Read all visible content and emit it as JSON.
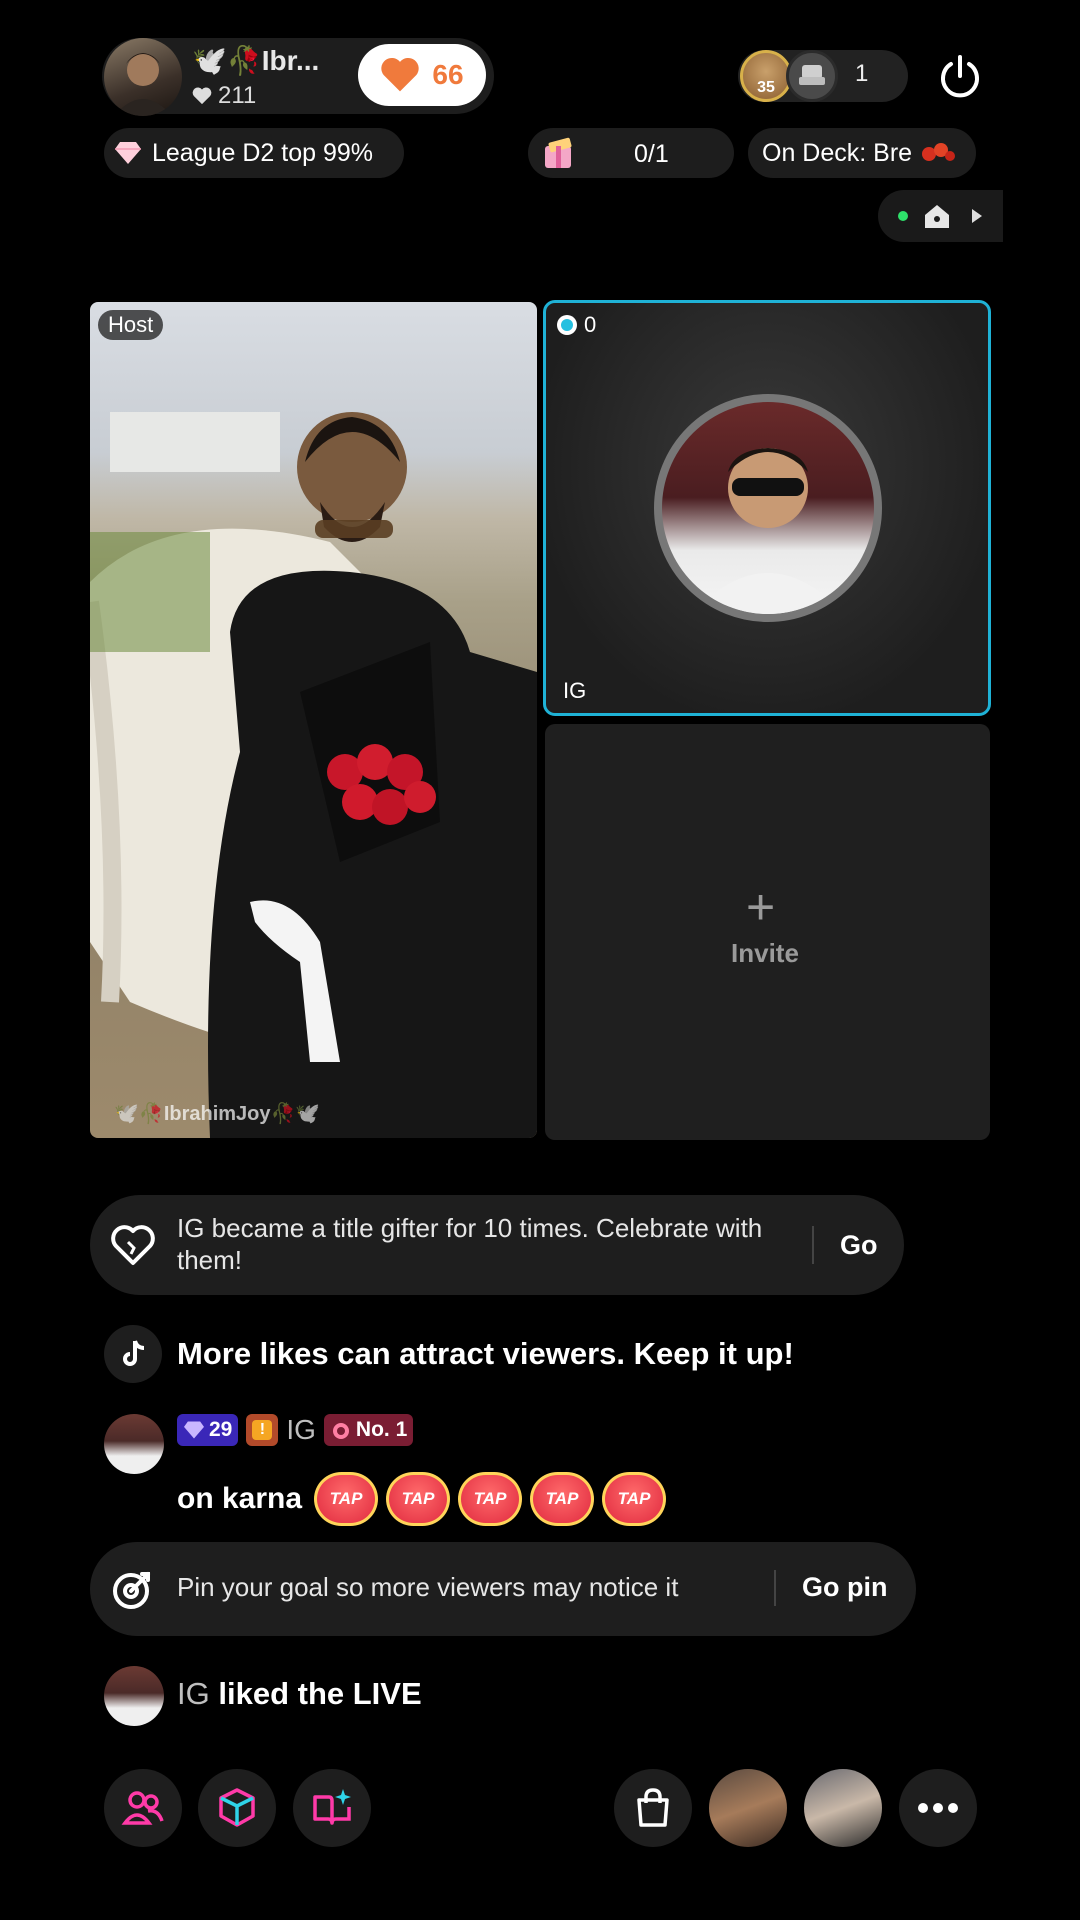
{
  "host": {
    "name": "Ibr...",
    "likes": "211",
    "like_button_count": "66",
    "tag": "Host",
    "watermark": "IbrahimJoy"
  },
  "viewers": {
    "badge_level": "35",
    "count": "1"
  },
  "league": {
    "label": "League D2 top 99%"
  },
  "goal": {
    "progress_text": "0/1"
  },
  "on_deck": {
    "label": "On Deck: Bre"
  },
  "guest": {
    "coin_count": "0",
    "name": "IG"
  },
  "invite": {
    "plus": "+",
    "label": "Invite"
  },
  "chat": {
    "banner1": {
      "text": "IG became a title gifter for 10 times. Celebrate with them!",
      "action": "Go"
    },
    "system_message": "More likes can attract viewers. Keep it up!",
    "comment": {
      "gem_level": "29",
      "fan_level": "!",
      "user": "IG",
      "rank_badge": "No. 1",
      "text": "on karna",
      "sticker_label": "TAP",
      "sticker_count": 5
    },
    "banner2": {
      "text": "Pin your goal so more viewers may notice it",
      "action": "Go pin"
    },
    "like_event": {
      "user": "IG",
      "action": "liked the LIVE"
    }
  },
  "colors": {
    "accent_cyan": "#1fb2d6",
    "like_orange": "#f07a3c",
    "pink_icon": "#ff3aa8",
    "gem_badge": "#3a27b8",
    "rank_badge": "#7a1d33"
  },
  "icons": [
    "heart-icon",
    "power-icon",
    "diamond-icon",
    "gift-box-icon",
    "home-icon",
    "play-arrow-icon",
    "coin-icon",
    "heart-outline-icon",
    "tiktok-icon",
    "target-icon",
    "people-icon",
    "cube-icon",
    "sparkle-book-icon",
    "shopping-bag-icon",
    "more-icon"
  ]
}
